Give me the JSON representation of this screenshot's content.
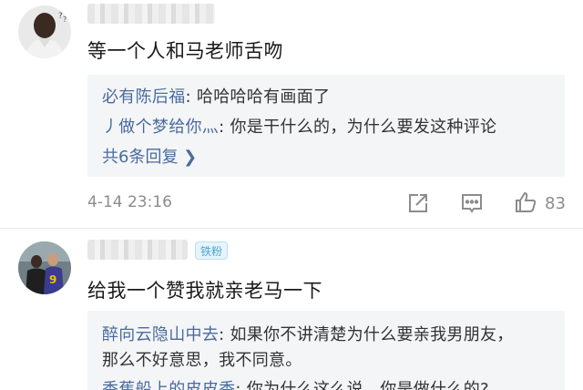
{
  "comments": [
    {
      "text": "等一个人和马老师舌吻",
      "replies": [
        {
          "name": "必有陈后福",
          "sep": ": ",
          "text": "哈哈哈哈有画面了"
        },
        {
          "name": "丿做个梦给你灬",
          "sep": ": ",
          "text": "你是干什么的，为什么要发这种评论"
        }
      ],
      "more_replies": "共6条回复 ❯",
      "time": "4-14 23:16",
      "likes": "83",
      "icons": [
        "share-icon",
        "reply-icon",
        "like-icon"
      ]
    },
    {
      "badge": "铁粉",
      "text": "给我一个赞我就亲老马一下",
      "replies": [
        {
          "name": "醉向云隐山中去",
          "sep": ": ",
          "text": "如果你不讲清楚为什么要亲我男朋友，",
          "text2": "那么不好意思，我不同意。"
        },
        {
          "name": "香蕉船上的皮皮香",
          "sep": ": ",
          "text": "你为什么这么说，你是做什么的?"
        }
      ]
    }
  ]
}
